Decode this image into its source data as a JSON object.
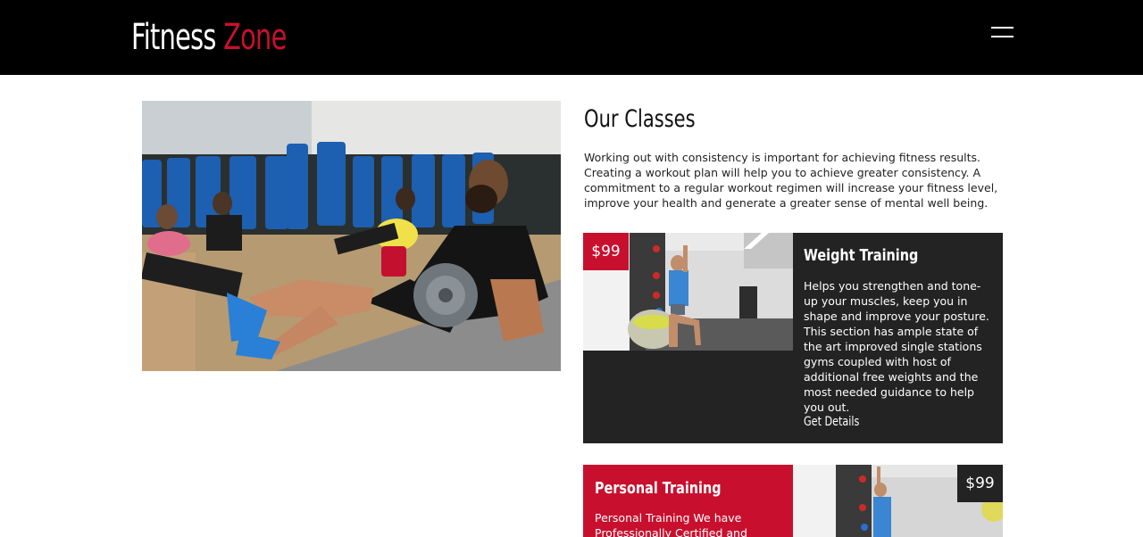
{
  "header": {
    "logo_part1": "Fitness",
    "logo_part2": "Zone",
    "menu_icon": "hamburger-menu-icon"
  },
  "main": {
    "title": "Our Classes",
    "intro": "Working out with consistency is important for achieving fitness results. Creating a workout plan will help you to achieve greater consistency. A commitment to a regular workout regimen will increase your fitness level, improve your health and generate a greater sense of mental well being."
  },
  "classes": [
    {
      "price": "$99",
      "title": "Weight Training",
      "description": "Helps you strengthen and tone-up your muscles, keep you in shape and improve your posture. This section has ample state of the art improved single stations gyms coupled with host of additional free weights and the most needed guidance to help you out.",
      "link": "Get Details"
    },
    {
      "price": "$99",
      "title": "Personal Training",
      "description": "Personal Training We have Professionally Certified and"
    }
  ],
  "colors": {
    "accent": "#c8102e",
    "dark": "#232323",
    "header": "#000000"
  }
}
